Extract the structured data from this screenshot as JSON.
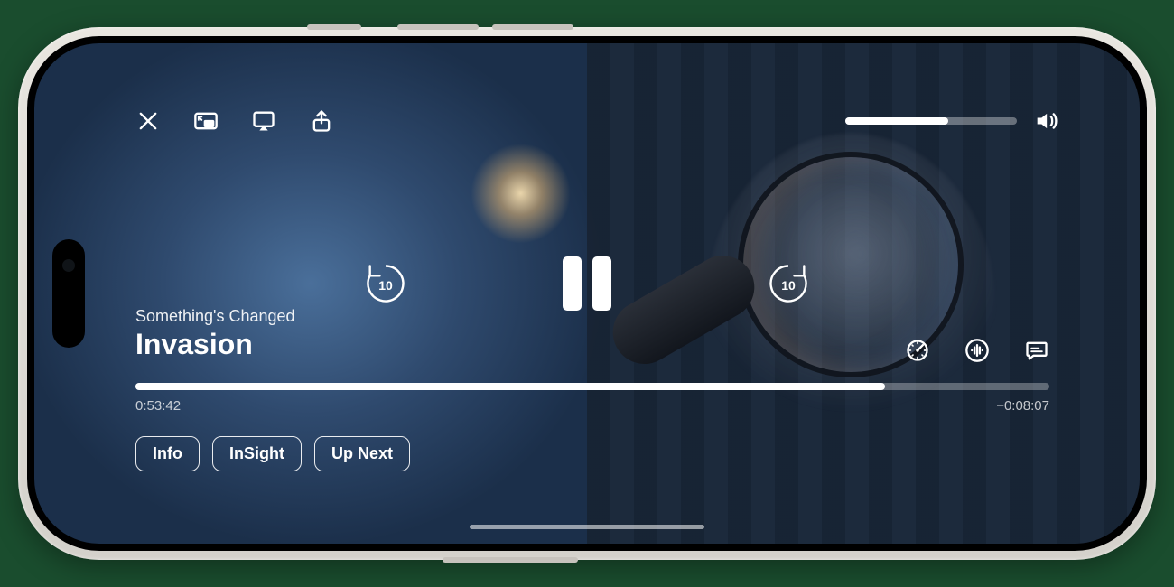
{
  "episode_label": "Something's Changed",
  "show_title": "Invasion",
  "time_elapsed": "0:53:42",
  "time_remaining": "−0:08:07",
  "progress_percent": 82,
  "volume_percent": 60,
  "skip_seconds": "10",
  "tabs": {
    "info": "Info",
    "insight": "InSight",
    "upnext": "Up Next"
  }
}
